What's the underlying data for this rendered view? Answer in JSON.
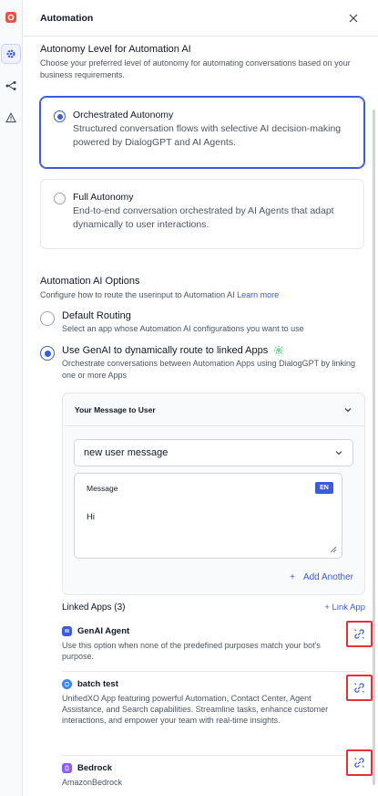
{
  "panel": {
    "title": "Automation"
  },
  "autonomy": {
    "title": "Autonomy Level for Automation AI",
    "description": "Choose your preferred level of autonomy for automating conversations based on your business requirements.",
    "options": [
      {
        "title": "Orchestrated Autonomy",
        "description": "Structured conversation flows with selective AI decision-making powered by DialogGPT and AI Agents.",
        "selected": true
      },
      {
        "title": "Full Autonomy",
        "description": "End-to-end conversation orchestrated by AI Agents that adapt dynamically to user interactions.",
        "selected": false
      }
    ]
  },
  "ai_options": {
    "title": "Automation AI Options",
    "description": "Configure how to route the userinput to Automation AI",
    "learn_more": "Learn more",
    "default_routing": {
      "title": "Default Routing",
      "description": "Select an app whose Automation AI configurations you want to use"
    },
    "genai_routing": {
      "title": "Use GenAI to dynamically route to linked Apps",
      "description": "Orchestrate conversations between Automation Apps using DialogGPT by linking one or more Apps"
    }
  },
  "message_box": {
    "header": "Your Message to User",
    "selected": "new user message",
    "field_label": "Message",
    "language": "EN",
    "value": "Hi",
    "add_another": "Add Another"
  },
  "linked_apps": {
    "title": "Linked Apps (3)",
    "link_app": "+ Link App",
    "apps": [
      {
        "name": "GenAI Agent",
        "description": "Use this option when none of the predefined purposes match your bot's purpose.",
        "icon_color": "#3b5bdb"
      },
      {
        "name": "batch test",
        "description": "UnifiedXO App featuring powerful Automation, Contact Center, Agent Assistance, and Search capabilities. Streamline tasks, enhance customer interactions, and empower your team with real-time insights.",
        "icon_color": "#3b82f6"
      },
      {
        "name": "Bedrock",
        "description": "AmazonBedrock",
        "icon_color": "#8b5cf6"
      }
    ]
  },
  "colors": {
    "accent": "#3b5bdb",
    "highlight": "#e5313b",
    "brand": "#e8534a"
  }
}
